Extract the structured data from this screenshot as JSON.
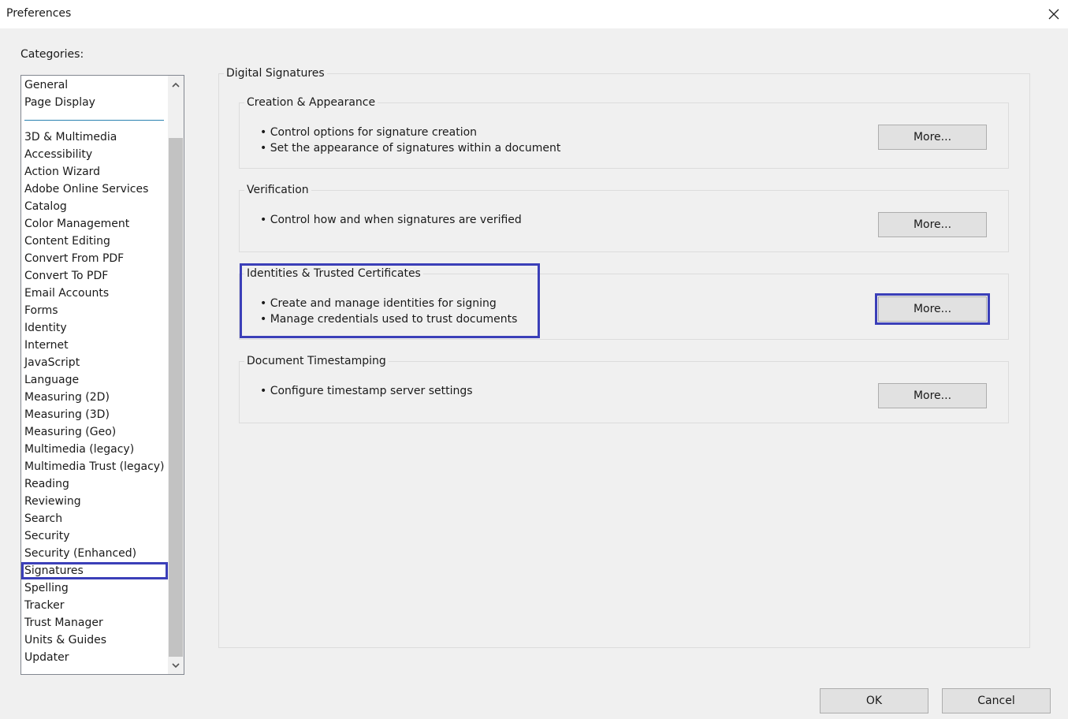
{
  "window": {
    "title": "Preferences",
    "close_icon": "close-icon"
  },
  "categories": {
    "label": "Categories:",
    "top_items": [
      "General",
      "Page Display"
    ],
    "items": [
      "3D & Multimedia",
      "Accessibility",
      "Action Wizard",
      "Adobe Online Services",
      "Catalog",
      "Color Management",
      "Content Editing",
      "Convert From PDF",
      "Convert To PDF",
      "Email Accounts",
      "Forms",
      "Identity",
      "Internet",
      "JavaScript",
      "Language",
      "Measuring (2D)",
      "Measuring (3D)",
      "Measuring (Geo)",
      "Multimedia (legacy)",
      "Multimedia Trust (legacy)",
      "Reading",
      "Reviewing",
      "Search",
      "Security",
      "Security (Enhanced)",
      "Signatures",
      "Spelling",
      "Tracker",
      "Trust Manager",
      "Units & Guides",
      "Updater"
    ],
    "selected": "Signatures"
  },
  "panel": {
    "title": "Digital Signatures",
    "sections": [
      {
        "title": "Creation & Appearance",
        "bullets": [
          "• Control options for signature creation",
          "• Set the appearance of signatures within a document"
        ],
        "button": "More..."
      },
      {
        "title": "Verification",
        "bullets": [
          "• Control how and when signatures are verified"
        ],
        "button": "More..."
      },
      {
        "title": "Identities & Trusted Certificates",
        "bullets": [
          "• Create and manage identities for signing",
          "• Manage credentials used to trust documents"
        ],
        "button": "More..."
      },
      {
        "title": "Document Timestamping",
        "bullets": [
          "• Configure timestamp server settings"
        ],
        "button": "More..."
      }
    ]
  },
  "footer": {
    "ok": "OK",
    "cancel": "Cancel"
  },
  "colors": {
    "highlight": "#3b3fb8",
    "separator": "#2a82b0"
  }
}
